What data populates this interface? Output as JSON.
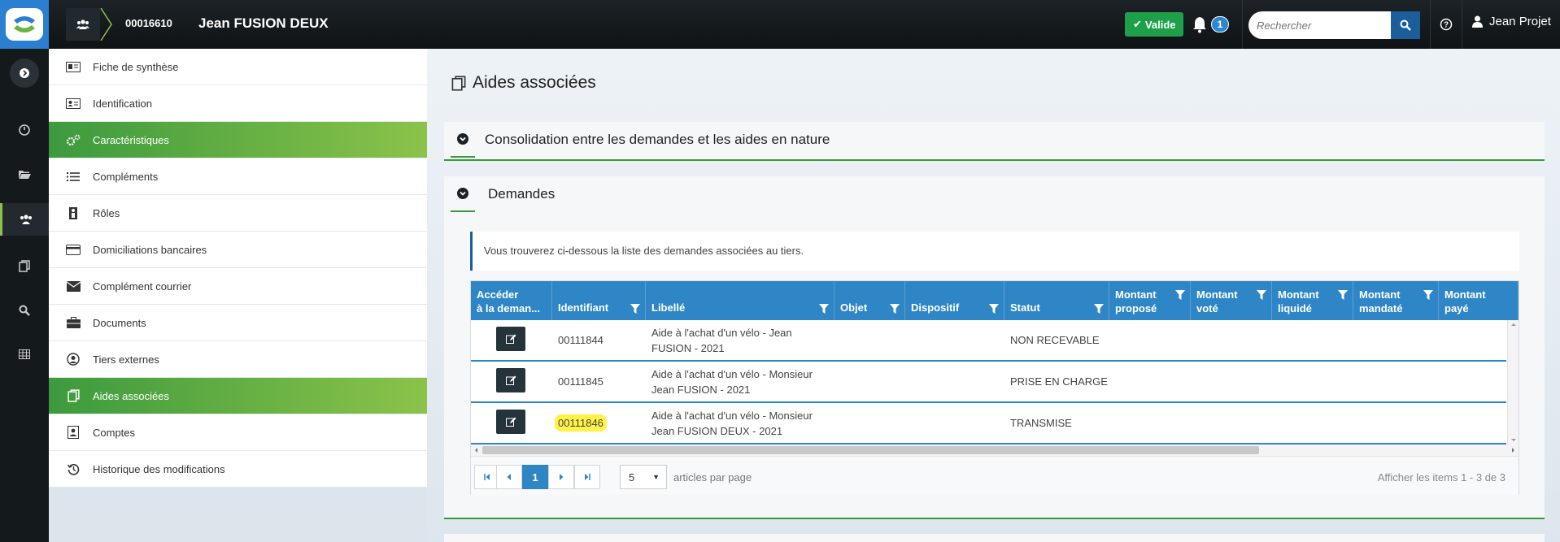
{
  "header": {
    "tiers_id": "00016610",
    "tiers_name": "Jean FUSION DEUX",
    "status_badge": "Valide",
    "notification_count": "1",
    "search_placeholder": "Rechercher",
    "user_name": "Jean Projet"
  },
  "sidebar": {
    "items": [
      {
        "label": "Fiche de synthèse",
        "icon": "id-card-icon"
      },
      {
        "label": "Identification",
        "icon": "address-card-icon"
      },
      {
        "label": "Caractéristiques",
        "icon": "cogs-icon"
      },
      {
        "label": "Compléments",
        "icon": "list-icon"
      },
      {
        "label": "Rôles",
        "icon": "user-role-icon"
      },
      {
        "label": "Domiciliations bancaires",
        "icon": "credit-card-icon"
      },
      {
        "label": "Complément courrier",
        "icon": "envelope-icon"
      },
      {
        "label": "Documents",
        "icon": "briefcase-icon"
      },
      {
        "label": "Tiers externes",
        "icon": "user-circle-icon"
      },
      {
        "label": "Aides associées",
        "icon": "copy-icon"
      },
      {
        "label": "Comptes",
        "icon": "account-icon"
      },
      {
        "label": "Historique des modifications",
        "icon": "history-icon"
      }
    ],
    "active_items": [
      "Caractéristiques",
      "Aides associées"
    ]
  },
  "main": {
    "page_title": "Aides associées",
    "panels": {
      "consolidation": "Consolidation entre les demandes et les aides en nature",
      "demandes": "Demandes"
    },
    "info_text": "Vous trouverez ci-dessous la liste des demandes associées au tiers.",
    "grid": {
      "columns": [
        {
          "line1": "Accéder",
          "line2": "à la deman..."
        },
        {
          "line1": "Identifiant",
          "line2": ""
        },
        {
          "line1": "Libellé",
          "line2": ""
        },
        {
          "line1": "Objet",
          "line2": ""
        },
        {
          "line1": "Dispositif",
          "line2": ""
        },
        {
          "line1": "Statut",
          "line2": ""
        },
        {
          "line1": "Montant",
          "line2": "proposé"
        },
        {
          "line1": "Montant",
          "line2": "voté"
        },
        {
          "line1": "Montant",
          "line2": "liquidé"
        },
        {
          "line1": "Montant",
          "line2": "mandaté"
        },
        {
          "line1": "Montant",
          "line2": "payé"
        }
      ],
      "rows": [
        {
          "id": "00111844",
          "libelle_1": "Aide à l'achat d'un vélo - Jean",
          "libelle_2": "FUSION - 2021",
          "statut": "NON RECEVABLE"
        },
        {
          "id": "00111845",
          "libelle_1": "Aide à l'achat d'un vélo - Monsieur",
          "libelle_2": "Jean FUSION - 2021",
          "statut": "PRISE EN CHARGE"
        },
        {
          "id": "00111846",
          "libelle_1": "Aide à l'achat d'un vélo - Monsieur",
          "libelle_2": "Jean FUSION DEUX - 2021",
          "statut": "TRANSMISE"
        }
      ],
      "pager": {
        "current_page": "1",
        "page_size": "5",
        "page_size_label": "articles par page",
        "info": "Afficher les items 1 - 3 de 3"
      }
    }
  },
  "colors": {
    "accent_green": "#8bc34a",
    "grid_header_blue": "#2f86c6",
    "highlight_yellow": "#fff34a",
    "valid_badge_green": "#1ea04b"
  }
}
